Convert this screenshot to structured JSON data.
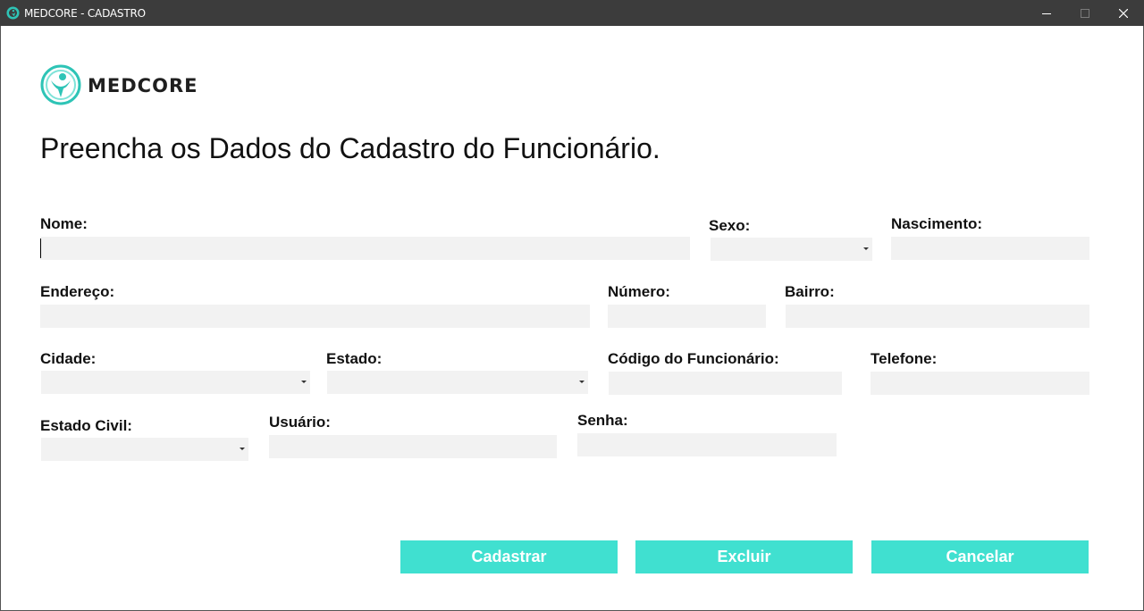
{
  "window": {
    "title": "MEDCORE - CADASTRO",
    "controls": {
      "minimize": "—",
      "maximize": "☐",
      "close": "✕"
    }
  },
  "brand": {
    "name": "MEDCORE",
    "logo_icon": "medcore-logo-icon",
    "accent": "#40e0d0"
  },
  "heading": "Preencha os Dados do Cadastro do Funcionário.",
  "form": {
    "nome": {
      "label": "Nome:",
      "value": ""
    },
    "sexo": {
      "label": "Sexo:",
      "value": ""
    },
    "nascimento": {
      "label": "Nascimento:",
      "value": ""
    },
    "endereco": {
      "label": "Endereço:",
      "value": ""
    },
    "numero": {
      "label": "Número:",
      "value": ""
    },
    "bairro": {
      "label": "Bairro:",
      "value": ""
    },
    "cidade": {
      "label": "Cidade:",
      "value": ""
    },
    "estado": {
      "label": "Estado:",
      "value": ""
    },
    "codigo": {
      "label": "Código do Funcionário:",
      "value": ""
    },
    "telefone": {
      "label": "Telefone:",
      "value": ""
    },
    "estado_civil": {
      "label": "Estado Civil:",
      "value": ""
    },
    "usuario": {
      "label": "Usuário:",
      "value": ""
    },
    "senha": {
      "label": "Senha:",
      "value": ""
    }
  },
  "buttons": {
    "cadastrar": "Cadastrar",
    "excluir": "Excluir",
    "cancelar": "Cancelar"
  },
  "colors": {
    "titlebar": "#3c3c3c",
    "field_bg": "#f2f2f2",
    "button_bg": "#40e0d0"
  }
}
